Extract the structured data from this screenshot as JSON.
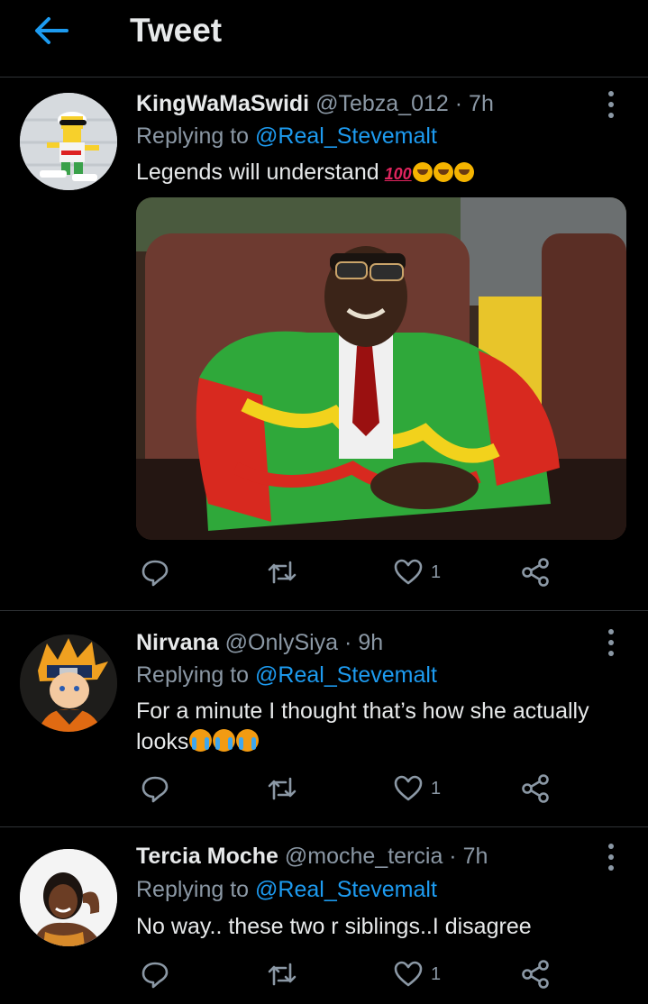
{
  "header": {
    "title": "Tweet"
  },
  "colors": {
    "accent": "#1d9bf0",
    "background": "#000000",
    "muted": "#8b98a5"
  },
  "tweets": [
    {
      "name": "KingWaMaSwidi",
      "handle": "@Tebza_012",
      "sep": "·",
      "time": "7h",
      "replying_label": "Replying to",
      "replying_to": "@Real_Stevemalt",
      "text": "Legends will understand",
      "text_emoji": [
        "100",
        "rofl",
        "rofl",
        "rofl"
      ],
      "has_media": true,
      "reply_icon": "reply-icon",
      "retweet_icon": "retweet-icon",
      "like_icon": "heart-icon",
      "like_count": "1",
      "share_icon": "share-icon"
    },
    {
      "name": "Nirvana",
      "handle": "@OnlySiya",
      "sep": "·",
      "time": "9h",
      "replying_label": "Replying to",
      "replying_to": "@Real_Stevemalt",
      "text_line1": "For a minute I thought that’s how she actually",
      "text_line2": "looks",
      "text_emoji": [
        "crying",
        "crying",
        "crying"
      ],
      "like_count": "1"
    },
    {
      "name": "Tercia Moche",
      "handle": "@moche_tercia",
      "sep": "·",
      "time": "7h",
      "replying_label": "Replying to",
      "replying_to": "@Real_Stevemalt",
      "text": "No way.. these two r siblings..I disagree",
      "like_count": "1"
    }
  ]
}
